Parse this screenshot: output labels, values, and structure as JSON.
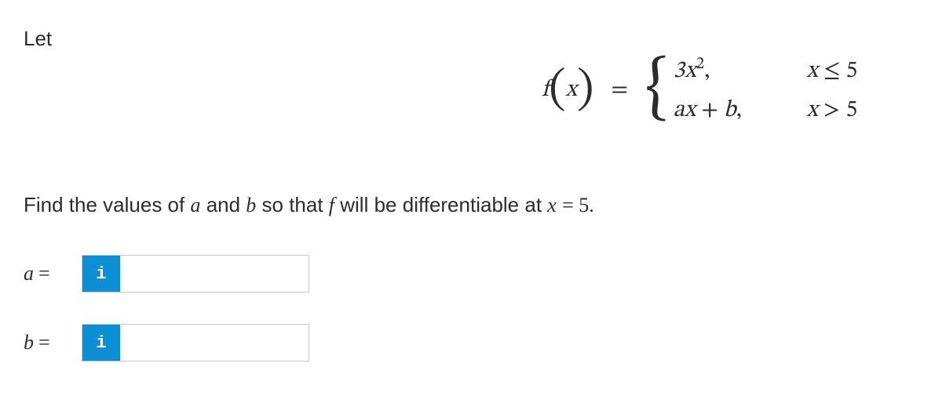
{
  "intro": "Let",
  "equation": {
    "func_name": "f",
    "func_arg": "x",
    "equals": "=",
    "case1_expr_html": "3<span class='ital'>x</span><span class='sup'>2</span><span class='norm'>,</span>",
    "case1_cond_html": "x <span class='norm'>≤ 5</span>",
    "case2_expr_html": "ax <span class='norm'>+</span> b<span class='norm'>,</span>",
    "case2_cond_html": "x <span class='norm'>> 5</span>"
  },
  "instruction_html": "Find the values of <span class='ital'>a</span> and <span class='ital'>b</span> so that <span class='ital'>f</span> will be differentiable at <span class='ital'>x</span> <span class='mathrm'>= 5.</span>",
  "answers": {
    "a_label": "a",
    "b_label": "b",
    "eq": "=",
    "info_icon": "i",
    "a_value": "",
    "b_value": ""
  }
}
